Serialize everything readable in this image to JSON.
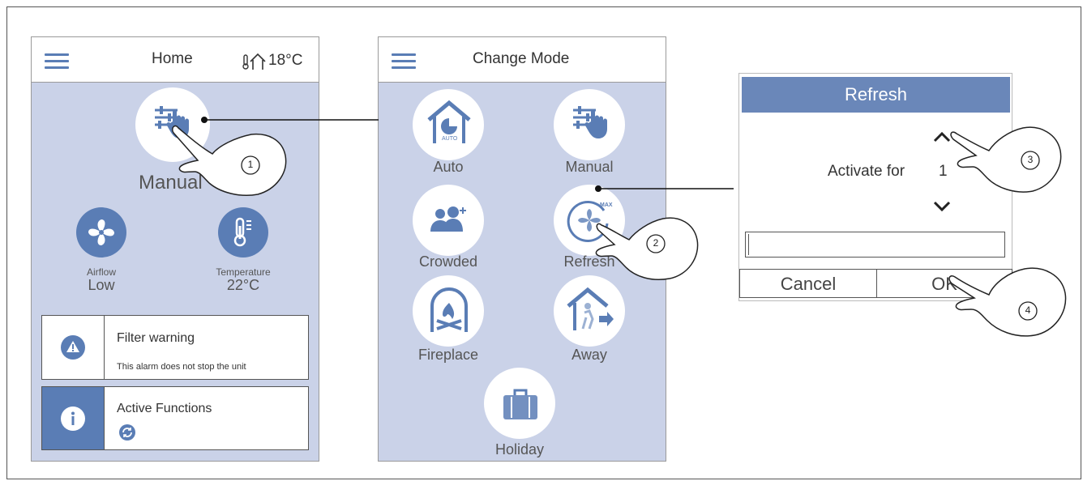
{
  "home": {
    "title": "Home",
    "temperature": "18°C",
    "mode_label": "Manual",
    "airflow_label": "Airflow",
    "airflow_value": "Low",
    "temperature_label": "Temperature",
    "temperature_value": "22°C",
    "filter_title": "Filter warning",
    "filter_text": "This alarm does not stop the unit",
    "active_title": "Active Functions"
  },
  "change_mode": {
    "title": "Change Mode",
    "modes": [
      "Auto",
      "Manual",
      "Crowded",
      "Refresh",
      "Fireplace",
      "Away",
      "Holiday"
    ],
    "auto_badge": "AUTO",
    "max_badge": "MAX"
  },
  "dialog": {
    "title": "Refresh",
    "activate_label": "Activate for",
    "activate_value": "1",
    "cancel": "Cancel",
    "ok": "OK"
  },
  "callouts": [
    "1",
    "2",
    "3",
    "4"
  ],
  "colors": {
    "accent": "#5a7db5",
    "screen_bg": "#cad2e8",
    "header": "#6a87b9"
  }
}
